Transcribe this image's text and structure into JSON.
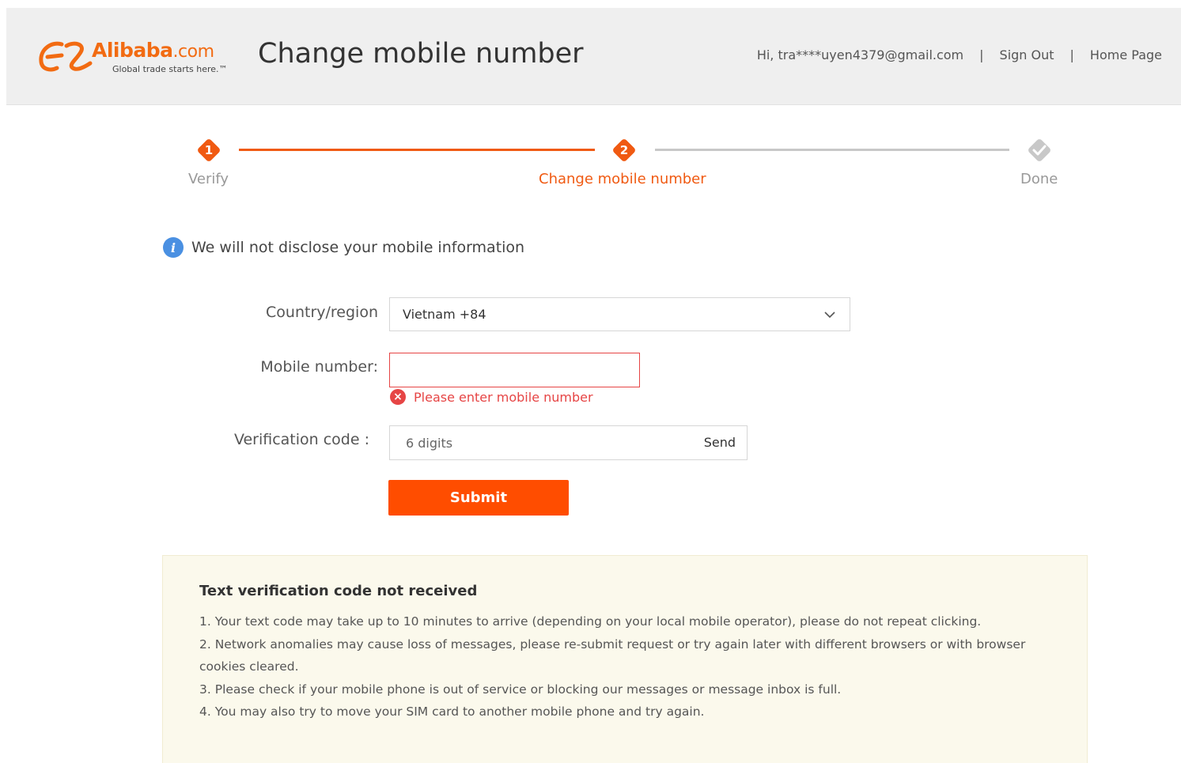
{
  "header": {
    "logo_word": "Alibaba",
    "logo_suffix": ".com",
    "logo_tagline": "Global trade starts here.™",
    "title": "Change mobile number",
    "greeting": "Hi, tra****uyen4379@gmail.com",
    "separator": "|",
    "sign_out": "Sign Out",
    "home_page": "Home Page"
  },
  "steps": [
    {
      "number": "1",
      "label": "Verify",
      "state": "completed"
    },
    {
      "number": "2",
      "label": "Change mobile number",
      "state": "active"
    },
    {
      "number": "",
      "label": "Done",
      "state": "pending",
      "icon": "check-icon"
    }
  ],
  "notice": {
    "icon": "info-icon",
    "text": "We will not disclose your mobile information"
  },
  "form": {
    "country_label": "Country/region",
    "country_value": "Vietnam +84",
    "mobile_label": "Mobile number:",
    "mobile_value": "",
    "mobile_error": "Please enter mobile number",
    "verify_label": "Verification code :",
    "verify_placeholder": "6 digits",
    "send_label": "Send",
    "submit_label": "Submit"
  },
  "help": {
    "title": "Text verification code not received",
    "items": [
      "1. Your text code may take up to 10 minutes to arrive (depending on your local mobile operator), please do not repeat clicking.",
      "2. Network anomalies may cause loss of messages, please re-submit request or try again later with different browsers or with browser cookies cleared.",
      "3. Please check if your mobile phone is out of service or blocking our messages or message inbox is full.",
      "4. You may also try to move your SIM card to another mobile phone and try again."
    ]
  },
  "colors": {
    "accent": "#f05a12",
    "submit": "#ff4d00",
    "error": "#e64545",
    "info": "#4a90e2",
    "header_bg": "#efefef",
    "help_bg": "#fbf9ec",
    "inactive": "#c8c8c8"
  }
}
